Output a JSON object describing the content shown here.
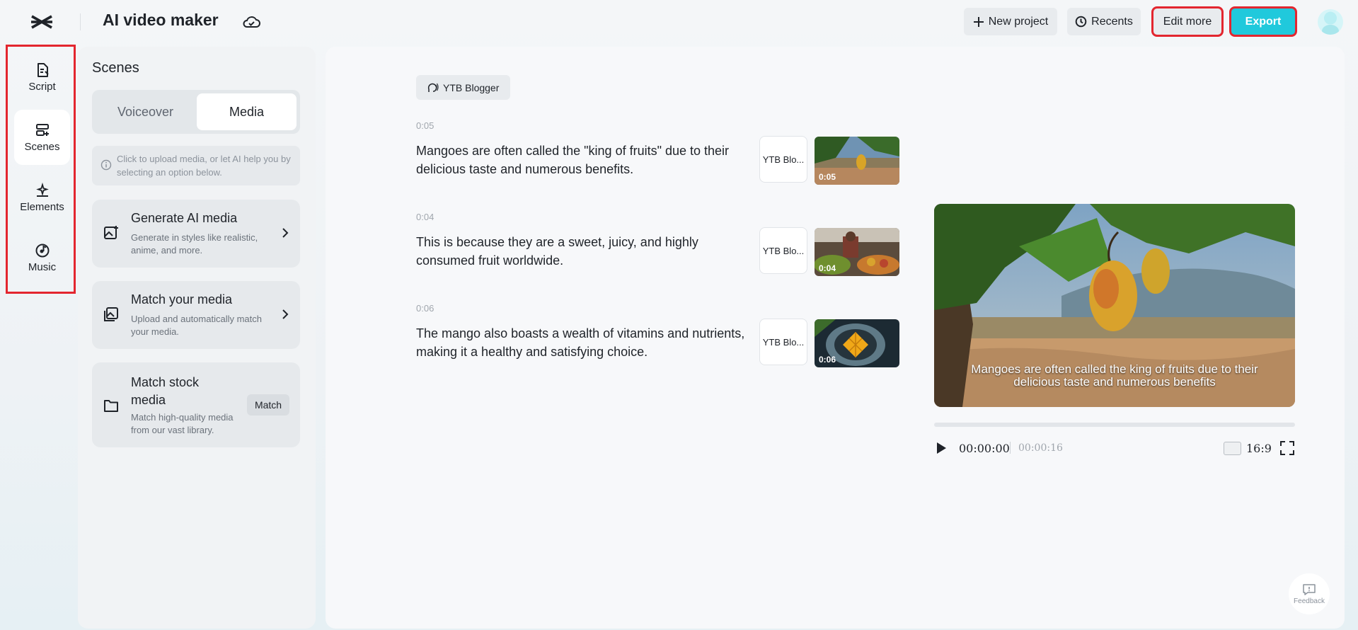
{
  "header": {
    "app_title": "AI video maker",
    "new_project": "New project",
    "recents": "Recents",
    "edit_more": "Edit more",
    "export": "Export"
  },
  "rail": {
    "items": [
      {
        "label": "Script",
        "icon": "script-icon"
      },
      {
        "label": "Scenes",
        "icon": "scenes-icon",
        "active": true
      },
      {
        "label": "Elements",
        "icon": "elements-icon"
      },
      {
        "label": "Music",
        "icon": "music-icon"
      }
    ]
  },
  "panel": {
    "title": "Scenes",
    "tabs": [
      "Voiceover",
      "Media"
    ],
    "selected_tab": "Media",
    "hint": "Click  to upload media, or let AI help you by selecting an option below.",
    "cards": [
      {
        "title": "Generate AI media",
        "desc": "Generate in styles like realistic, anime, and more.",
        "icon": "ai-image-icon"
      },
      {
        "title": "Match your media",
        "desc": "Upload and automatically match your media.",
        "icon": "gallery-icon"
      },
      {
        "title": "Match stock media",
        "desc": "Match high-quality media from our vast library.",
        "icon": "folder-icon",
        "button": "Match"
      }
    ]
  },
  "editor": {
    "voice_chip": "YTB Blogger",
    "scenes": [
      {
        "time": "0:05",
        "text": "Mangoes are often called the \"king of fruits\" due to their delicious taste and numerous benefits.",
        "voice": "YTB Blo...",
        "duration": "0:05"
      },
      {
        "time": "0:04",
        "text": "This is because they are a sweet, juicy, and highly consumed fruit worldwide.",
        "voice": "YTB Blo...",
        "duration": "0:04"
      },
      {
        "time": "0:06",
        "text": "The mango also boasts a wealth of vitamins and nutrients, making it a healthy and satisfying choice.",
        "voice": "YTB Blo...",
        "duration": "0:06"
      }
    ]
  },
  "preview": {
    "subtitle": "Mangoes are often called the  king of fruits  due to their delicious taste and numerous benefits",
    "current_time": "00:00:00",
    "total_time": "00:00:16",
    "aspect_ratio": "16:9",
    "progress": 0.0
  },
  "feedback": "Feedback",
  "colors": {
    "accent": "#20c9dc",
    "highlight": "#e3262f"
  }
}
